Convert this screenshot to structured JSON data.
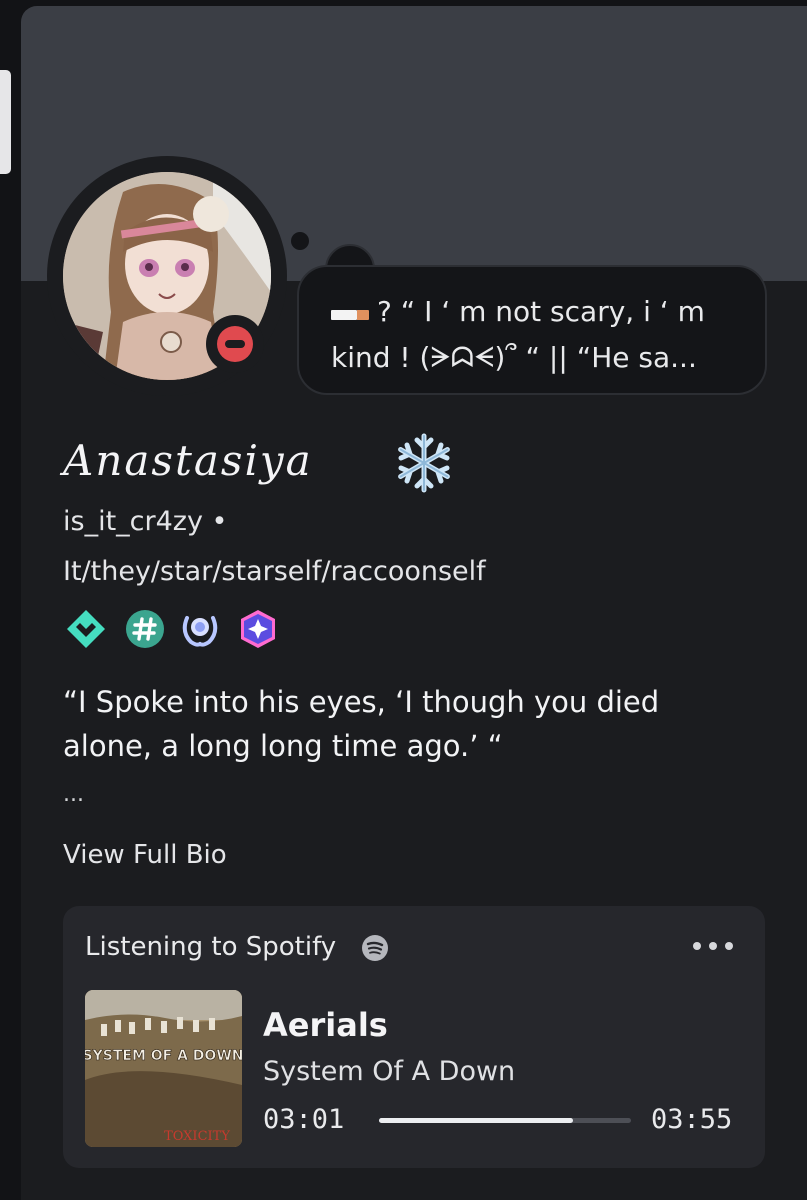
{
  "status_bubble": {
    "icon": "cigarette-icon",
    "text_line1": "? “ I ‘ m not scary, i ‘ m",
    "text_line2": "kind ! (ᗒᗣᗕ)՞ “ || “He sa..."
  },
  "profile": {
    "display_name": "Anastasiya",
    "display_name_emoji": "snowflake-icon",
    "username": "is_it_cr4zy •",
    "pronouns": "It/they/star/starself/raccoonself",
    "status": "do-not-disturb",
    "badges": [
      "hypesquad-balance-icon",
      "hashtag-icon",
      "laurel-icon",
      "nitro-gem-icon"
    ],
    "bio_line1": "“I Spoke into his eyes, ‘I though you died",
    "bio_line2": "alone, a long long time ago.’ “",
    "bio_more": "...",
    "view_full_bio": "View Full Bio"
  },
  "activity": {
    "heading": "Listening to Spotify",
    "track": "Aerials",
    "artist": "System Of A Down",
    "elapsed": "03:01",
    "duration": "03:55",
    "progress": 0.77,
    "album_art_text": "SYSTEM OF A DOWN",
    "album_art_sub": "TOXICITY"
  },
  "colors": {
    "banner": "#3b3e45",
    "dnd_red": "#e04a4f",
    "card_bg": "#1b1c1f",
    "activity_bg": "#26272c"
  }
}
